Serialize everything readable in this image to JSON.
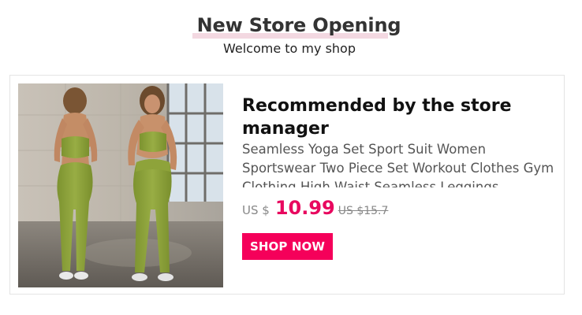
{
  "header": {
    "title": "New Store Opening",
    "subtitle": "Welcome to my shop"
  },
  "product": {
    "section_title": "Recommended by the store manager",
    "description": "Seamless Yoga Set Sport Suit Women Sportswear Two Piece Set Workout Clothes Gym Clothing High Waist Seamless Leggings",
    "currency": "US $",
    "price": "10.99",
    "original_price": "US $15.7",
    "cta_label": "SHOP NOW",
    "image_desc": "product-photo"
  },
  "colors": {
    "accent": "#f5005a",
    "price": "#e8085f",
    "title_highlight": "#f3d8e1",
    "outfit": "#8aa033"
  }
}
